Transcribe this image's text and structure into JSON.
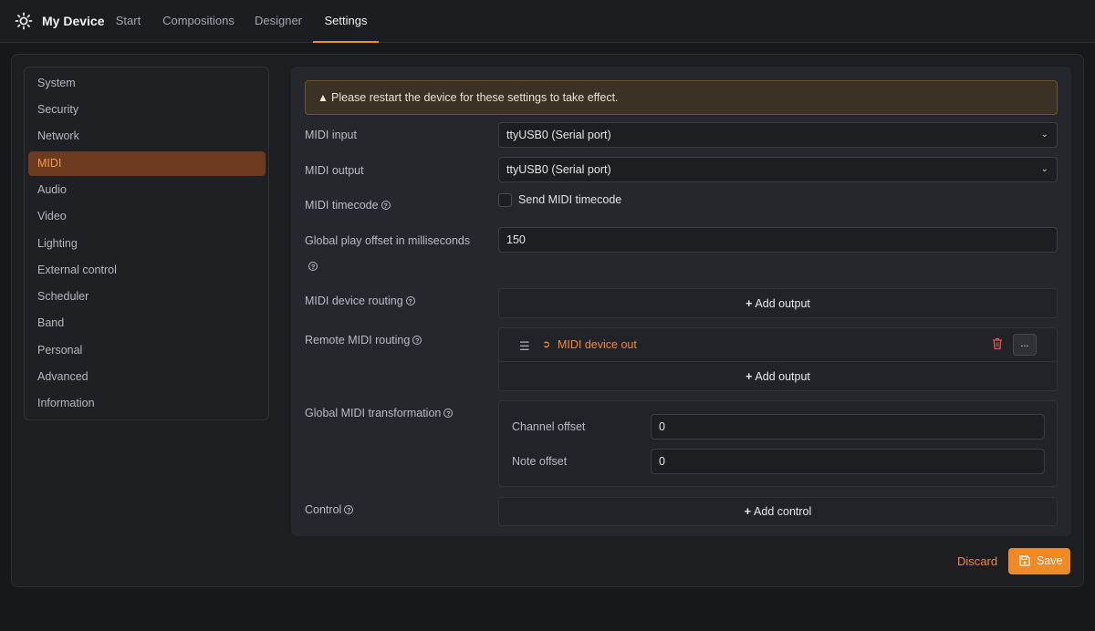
{
  "app": {
    "title": "My Device",
    "logo_icon": "sun-icon"
  },
  "nav": {
    "tabs": [
      {
        "label": "Start"
      },
      {
        "label": "Compositions"
      },
      {
        "label": "Designer"
      },
      {
        "label": "Settings",
        "active": true
      }
    ],
    "accent": "#f08c2e"
  },
  "sidebar": {
    "items": [
      {
        "label": "System"
      },
      {
        "label": "Security"
      },
      {
        "label": "Network"
      },
      {
        "label": "MIDI",
        "active": true
      },
      {
        "label": "Audio"
      },
      {
        "label": "Video"
      },
      {
        "label": "Lighting"
      },
      {
        "label": "External control"
      },
      {
        "label": "Scheduler"
      },
      {
        "label": "Band"
      },
      {
        "label": "Personal"
      },
      {
        "label": "Advanced"
      },
      {
        "label": "Information"
      }
    ]
  },
  "warning": {
    "icon": "warning-triangle-icon",
    "text": "Please restart the device for these settings to take effect."
  },
  "settings": {
    "midi_input": {
      "label": "MIDI input",
      "value": "ttyUSB0 (Serial port)"
    },
    "midi_output": {
      "label": "MIDI output",
      "value": "ttyUSB0 (Serial port)"
    },
    "midi_timecode": {
      "label": "MIDI timecode",
      "checkbox_label": "Send MIDI timecode",
      "checked": false
    },
    "play_offset": {
      "label": "Global play offset in milliseconds",
      "value": "150"
    },
    "device_routing": {
      "label": "MIDI device routing",
      "add_label": "Add output"
    },
    "remote_routing": {
      "label": "Remote MIDI routing",
      "routes": [
        {
          "label": "MIDI device out",
          "icon": "sign-out-icon"
        }
      ],
      "more_label": "...",
      "add_label": "Add output"
    },
    "transformation": {
      "label": "Global MIDI transformation",
      "channel_offset": {
        "label": "Channel offset",
        "value": "0"
      },
      "note_offset": {
        "label": "Note offset",
        "value": "0"
      }
    },
    "control": {
      "label": "Control",
      "add_label": "Add control"
    }
  },
  "footer": {
    "discard_label": "Discard",
    "save_label": "Save"
  },
  "help_glyph": "?"
}
